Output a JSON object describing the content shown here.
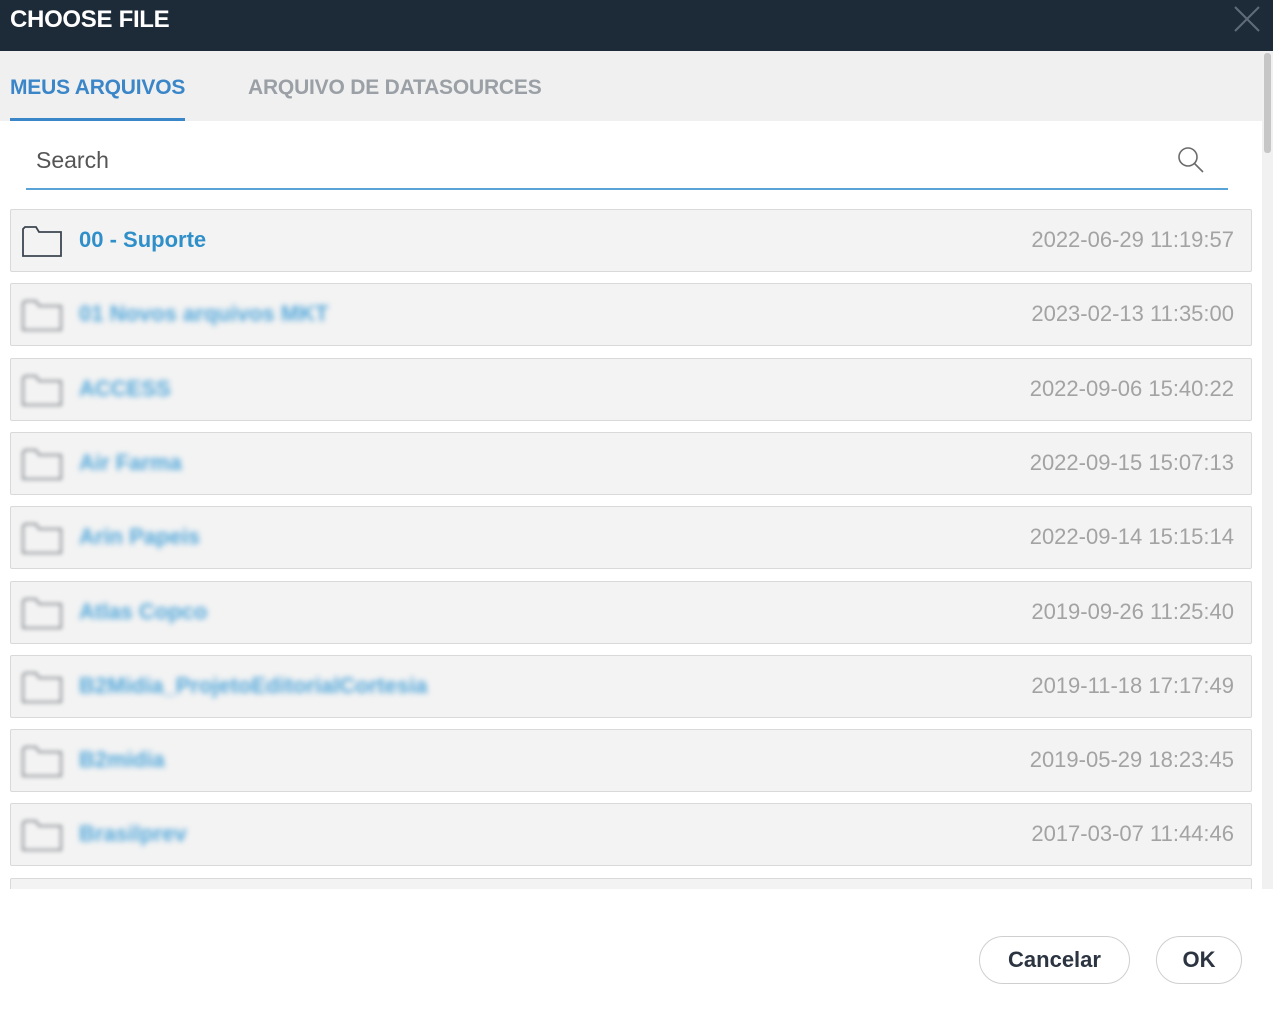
{
  "dialog": {
    "title": "CHOOSE FILE"
  },
  "tabs": [
    {
      "label": "MEUS ARQUIVOS",
      "active": true
    },
    {
      "label": "ARQUIVO DE DATASOURCES",
      "active": false
    }
  ],
  "search": {
    "placeholder": "Search",
    "value": ""
  },
  "files": [
    {
      "name": "00 - Suporte",
      "date": "2022-06-29 11:19:57",
      "blurred": false
    },
    {
      "name": "01 Novos arquivos MKT",
      "date": "2023-02-13 11:35:00",
      "blurred": true
    },
    {
      "name": "ACCESS",
      "date": "2022-09-06 15:40:22",
      "blurred": true
    },
    {
      "name": "Air Farma",
      "date": "2022-09-15 15:07:13",
      "blurred": true
    },
    {
      "name": "Arin Papeis",
      "date": "2022-09-14 15:15:14",
      "blurred": true
    },
    {
      "name": "Atlas Copco",
      "date": "2019-09-26 11:25:40",
      "blurred": true
    },
    {
      "name": "B2Midia_ProjetoEditorialCortesia",
      "date": "2019-11-18 17:17:49",
      "blurred": true
    },
    {
      "name": "B2midia",
      "date": "2019-05-29 18:23:45",
      "blurred": true
    },
    {
      "name": "Brasilprev",
      "date": "2017-03-07 11:44:46",
      "blurred": true
    }
  ],
  "footer": {
    "cancel_label": "Cancelar",
    "ok_label": "OK"
  },
  "colors": {
    "titlebar": "#1d2a38",
    "accent": "#3a86c8",
    "file_name": "#2f8fc9",
    "date_text": "#a3a3a3"
  },
  "icons": {
    "close": "close-icon",
    "search": "search-icon",
    "folder": "folder-icon"
  }
}
